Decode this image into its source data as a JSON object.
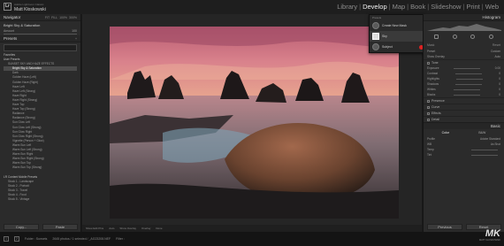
{
  "app": {
    "brand": "Adobe Lightroom Classic",
    "user": "Matt Kloskowski"
  },
  "modules": [
    "Library",
    "Develop",
    "Map",
    "Book",
    "Slideshow",
    "Print",
    "Web"
  ],
  "active_module": "Develop",
  "left": {
    "navigator_title": "Navigator",
    "navigator_tools": [
      "FIT",
      "FILL",
      "100%",
      "300%"
    ],
    "preview_name": "Bright Sky & Saturation",
    "preview_amount_label": "Amount",
    "preview_amount_value": "100",
    "presets_title": "Presets",
    "preset_groups": [
      {
        "label": "Favorites",
        "type": "group"
      },
      {
        "label": "User Presets",
        "type": "group"
      },
      {
        "label": "SUNSET SKY AND HAZE EFFECTS",
        "type": "sub"
      },
      {
        "label": "Bright Sky & Saturation",
        "type": "item",
        "selected": true
      },
      {
        "label": "Dark",
        "type": "item"
      },
      {
        "label": "Golden Haze (Left)",
        "type": "item"
      },
      {
        "label": "Golden Haze (Right)",
        "type": "item"
      },
      {
        "label": "Haze Left",
        "type": "item"
      },
      {
        "label": "Haze Left (Strong)",
        "type": "item"
      },
      {
        "label": "Haze Right",
        "type": "item"
      },
      {
        "label": "Haze Right (Strong)",
        "type": "item"
      },
      {
        "label": "Haze Top",
        "type": "item"
      },
      {
        "label": "Haze Top (Strong)",
        "type": "item"
      },
      {
        "label": "Radiance",
        "type": "item"
      },
      {
        "label": "Radiance (Strong)",
        "type": "item"
      },
      {
        "label": "Sun Glow Left",
        "type": "item"
      },
      {
        "label": "Sun Glow Left (Strong)",
        "type": "item"
      },
      {
        "label": "Sun Glow Right",
        "type": "item"
      },
      {
        "label": "Sun Glow Right (Strong)",
        "type": "item"
      },
      {
        "label": "Vignette (Person + Glow)",
        "type": "item"
      },
      {
        "label": "Warm Sun Left",
        "type": "item"
      },
      {
        "label": "Warm Sun Left (Strong)",
        "type": "item"
      },
      {
        "label": "Warm Sun Right",
        "type": "item"
      },
      {
        "label": "Warm Sun Right (Strong)",
        "type": "item"
      },
      {
        "label": "Warm Sun Top",
        "type": "item"
      },
      {
        "label": "Warm Sun Top (Strong)",
        "type": "item"
      },
      {
        "label": "",
        "type": "spacer"
      },
      {
        "label": "LR Content Mobile Presets",
        "type": "group"
      },
      {
        "label": "Stock 1 - Landscape",
        "type": "sub"
      },
      {
        "label": "Stock 2 - Portrait",
        "type": "sub"
      },
      {
        "label": "Stock 3 - Travel",
        "type": "sub"
      },
      {
        "label": "Stock 4 - Food",
        "type": "sub"
      },
      {
        "label": "Stock 5 - Vintage",
        "type": "sub"
      }
    ],
    "copy_label": "Copy...",
    "paste_label": "Paste"
  },
  "popup": {
    "header": "Presets",
    "rows": [
      {
        "label": "Create New Mask"
      },
      {
        "label": "Sky"
      },
      {
        "label": "Subject"
      }
    ]
  },
  "right": {
    "histogram_title": "Histogram",
    "mask_label": "Mask",
    "mask_state": "Reset",
    "preset_label": "Preset",
    "preset_value": "Custom",
    "show_overlay_label": "Show Overlay",
    "auto_label": "Auto",
    "sliders": [
      {
        "label": "Exposure",
        "value": "0.00"
      },
      {
        "label": "Contrast",
        "value": "0"
      },
      {
        "label": "Highlights",
        "value": "0"
      },
      {
        "label": "Shadows",
        "value": "0"
      },
      {
        "label": "Whites",
        "value": "0"
      },
      {
        "label": "Blacks",
        "value": "0"
      }
    ],
    "sections": [
      "Tone",
      "Presence",
      "Curve",
      "Effects",
      "Detail"
    ],
    "basic_title": "Basic",
    "treatment": [
      "Color",
      "B&W"
    ],
    "profile_label": "Profile",
    "profile_value": "Adobe Standard",
    "wb_label": "WB",
    "wb_value": "As Shot",
    "temp_label": "Temp",
    "tint_label": "Tint",
    "previous_label": "Previous",
    "reset_label": "Reset"
  },
  "center": {
    "toolbar_items": [
      "Show Edit Pins",
      "Auto",
      "Show Overlay",
      "Overlay"
    ],
    "done_label": "Done"
  },
  "status": {
    "page_numbers": [
      "1",
      "2"
    ],
    "items": [
      "Folder : Sunsets",
      "2645 photos / 1 selected / _AG23208.NEF"
    ],
    "filter_label": "Filter :"
  },
  "watermark": {
    "text": "MK",
    "sub": "MATT KLOSKOWSKI"
  }
}
